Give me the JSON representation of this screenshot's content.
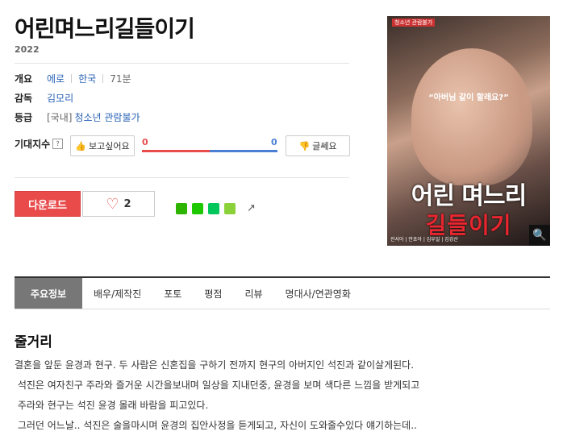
{
  "movie": {
    "title": "어린며느리길들이기",
    "year": "2022"
  },
  "info": {
    "overview_label": "개요",
    "genre": "에로",
    "country": "한국",
    "runtime": "71분",
    "director_label": "감독",
    "director": "김모리",
    "rating_label": "등급",
    "rating_region": "[국내]",
    "rating": "청소년 관람불가"
  },
  "expect": {
    "label": "기대지수",
    "help": "?",
    "want_label": "보고싶어요",
    "want_count": "0",
    "notwant_count": "0",
    "notwant_label": "글쎄요"
  },
  "actions": {
    "download_label": "다운로드",
    "like_count": "2"
  },
  "poster": {
    "tag": "청소년 관람불가",
    "quote": "“아버님 같이 할래요?”",
    "title_line1": "어린 며느리",
    "title_line2": "길들이기",
    "cast": "진서아 | 안초아 | 김우일 | 김강산"
  },
  "tabs": [
    "주요정보",
    "배우/제작진",
    "포토",
    "평점",
    "리뷰",
    "명대사/연관영화"
  ],
  "synopsis": {
    "title": "줄거리",
    "lines": [
      "결혼을 앞둔 윤경과 현구. 두 사람은 신혼집을 구하기 전까지 현구의 아버지인 석진과 같이살게된다.",
      " 석진은 여자친구 주라와 즐거운 시간을보내며 일상을 지내던중, 윤경을 보며 색다른 느낌을 받게되고",
      " 주라와 현구는 석진 윤경 몰래 바람을 피고있다.",
      " 그러던 어느날.. 석진은 술을마시며 윤경의 집안사정을 듣게되고, 자신이 도와줄수있다 얘기하는데.."
    ]
  },
  "colors": {
    "accent_red": "#e94b4b",
    "link_blue": "#2a63b5",
    "bar_blue": "#4a7fd4"
  }
}
